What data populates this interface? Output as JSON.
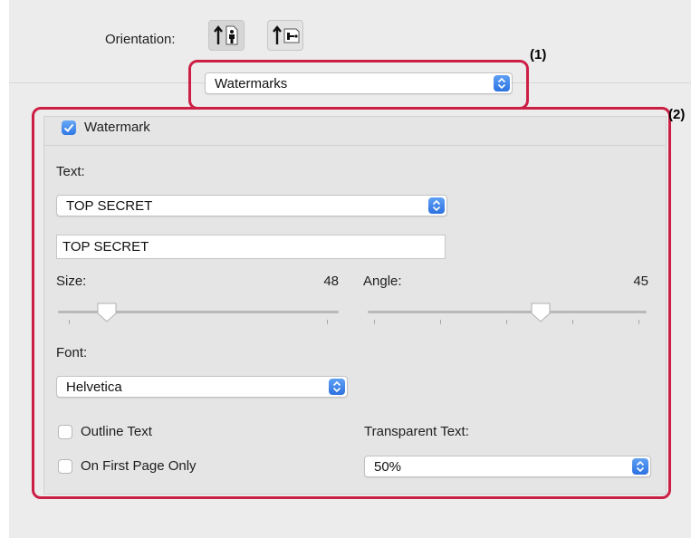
{
  "orientation": {
    "label": "Orientation:",
    "selected": "portrait"
  },
  "preset_popup": {
    "value": "Watermarks"
  },
  "callouts": {
    "one": "(1)",
    "two": "(2)"
  },
  "watermark": {
    "checkbox_label": "Watermark",
    "checked": true,
    "text_label": "Text:",
    "text_popup_value": "TOP SECRET",
    "text_field_value": "TOP SECRET",
    "size_label": "Size:",
    "size_value": "48",
    "angle_label": "Angle:",
    "angle_value": "45",
    "font_label": "Font:",
    "font_value": "Helvetica",
    "outline_label": "Outline Text",
    "outline_checked": false,
    "first_page_label": "On First Page Only",
    "first_page_checked": false,
    "transparent_label": "Transparent Text:",
    "transparent_value": "50%"
  },
  "colors": {
    "callout": "#cc1f45",
    "accent": "#2f78e6"
  }
}
